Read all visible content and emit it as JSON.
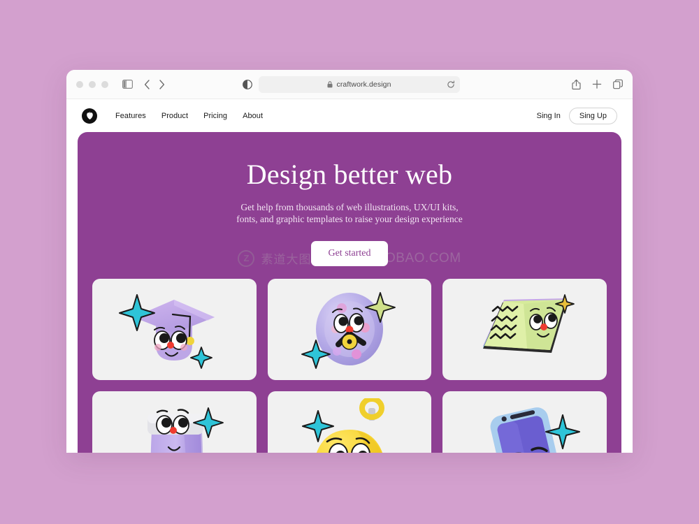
{
  "background_color": "#d3a0ce",
  "browser": {
    "traffic_lights": [
      "close-button",
      "minimize-button",
      "maximize-button"
    ],
    "sidebar_toggle_label": "sidebar-toggle",
    "back_label": "back",
    "forward_label": "forward",
    "reader_label": "reader-mode",
    "url": "craftwork.design",
    "lock_label": "secure-lock",
    "reload_label": "reload",
    "share_label": "share",
    "new_tab_label": "new-tab",
    "tabs_label": "show-tabs"
  },
  "site_nav": {
    "logo_label": "craftwork-logo",
    "links": [
      {
        "label": "Features"
      },
      {
        "label": "Product"
      },
      {
        "label": "Pricing"
      },
      {
        "label": "About"
      }
    ],
    "sign_in": "Sing In",
    "sign_up": "Sing Up"
  },
  "hero": {
    "title": "Design better web",
    "subtitle_line1": "Get help from thousands of web illustrations, UX/UI kits,",
    "subtitle_line2": "fonts, and graphic templates to raise your design experience",
    "cta_label": "Get started",
    "background_color": "#8e4093",
    "cta_text_color": "#8e4093"
  },
  "watermark": {
    "logo_letter": "Z",
    "chinese_text": "素道大图",
    "url_text": "JAMDK.TAOBAO.COM"
  },
  "cards": [
    {
      "name": "graduation-cap-illustration",
      "alt": "Purple graduation cap character with face and teal sparkles"
    },
    {
      "name": "palette-sphere-illustration",
      "alt": "Purple sphere palette character with brush and sparkles"
    },
    {
      "name": "open-book-illustration",
      "alt": "Green open book character with squiggle text and gold star"
    },
    {
      "name": "paint-tube-illustration",
      "alt": "Purple paint tube character with teal sparkle"
    },
    {
      "name": "bell-illustration",
      "alt": "Yellow bell character with teal sparkle"
    },
    {
      "name": "phone-illustration",
      "alt": "Blue phone character with teal sparkle"
    }
  ]
}
